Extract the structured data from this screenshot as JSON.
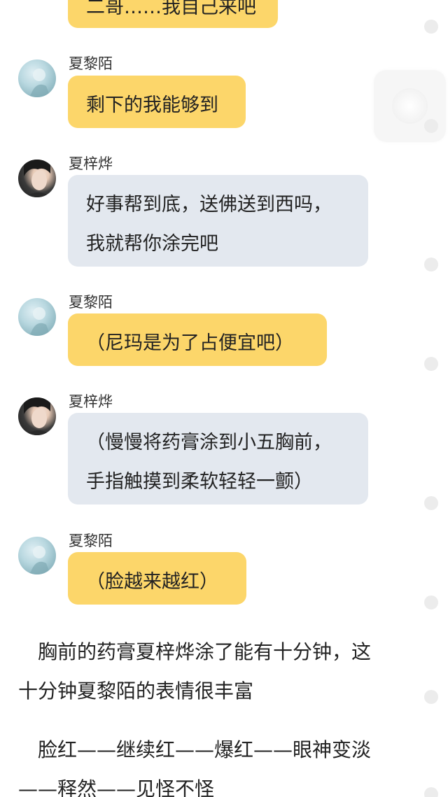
{
  "chat": {
    "top_partial": {
      "text": "二哥……我自己来吧"
    },
    "messages": [
      {
        "sender": "夏黎陌",
        "lines": [
          "剩下的我能够到"
        ]
      },
      {
        "sender": "夏梓烨",
        "lines": [
          "好事帮到底，送佛送到西吗，",
          "我就帮你涂完吧"
        ]
      },
      {
        "sender": "夏黎陌",
        "lines": [
          "（尼玛是为了占便宜吧）"
        ]
      },
      {
        "sender": "夏梓烨",
        "lines": [
          "（慢慢将药膏涂到小五胸前，",
          "手指触摸到柔软轻轻一颤）"
        ]
      },
      {
        "sender": "夏黎陌",
        "lines": [
          "（脸越来越红）"
        ]
      }
    ]
  },
  "narration": [
    [
      "　胸前的药膏夏梓烨涂了能有十分钟，这",
      "十分钟夏黎陌的表情很丰富"
    ],
    [
      "　脸红——继续红——爆红——眼神变淡",
      "——释然——见怪不怪"
    ]
  ],
  "colors": {
    "yellow_bubble": "#fcd66a",
    "gray_bubble": "#e3e8ef",
    "text": "#222222"
  }
}
